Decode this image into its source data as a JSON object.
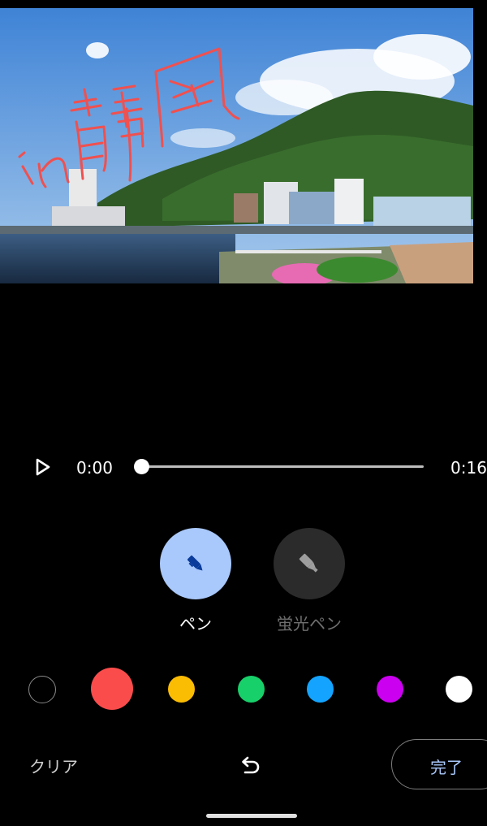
{
  "player": {
    "current_time": "0:00",
    "total_time": "0:16",
    "progress": 0
  },
  "tools": {
    "pen_label": "ペン",
    "highlighter_label": "蛍光ペン",
    "selected": "pen"
  },
  "colors": {
    "swatches": [
      "#000000",
      "#fb4c4c",
      "#fbbc04",
      "#18d06a",
      "#14a4ff",
      "#cc00f0",
      "#ffffff"
    ],
    "selected_index": 1
  },
  "actions": {
    "clear_label": "クリア",
    "done_label": "完了"
  }
}
